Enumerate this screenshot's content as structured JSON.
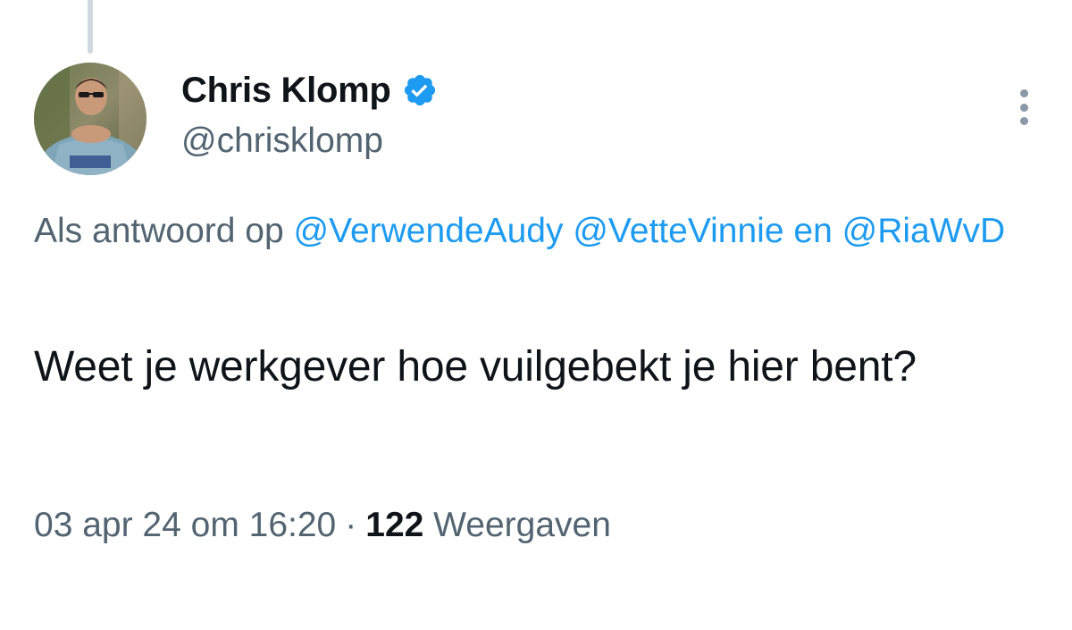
{
  "tweet": {
    "author": {
      "display_name": "Chris Klomp",
      "handle": "@chrisklomp",
      "verified": true,
      "avatar_icon": "user-photo"
    },
    "reply_context": {
      "prefix": "Als antwoord op",
      "mention_1": "@VerwendeAudy",
      "mention_2": "@VetteVinnie",
      "joiner": "en",
      "mention_3": "@RiaWvD"
    },
    "text": "Weet je werkgever hoe vuilgebekt je hier bent?",
    "timestamp": "03 apr 24 om 16:20",
    "separator": "·",
    "views_count": "122",
    "views_label": "Weergaven"
  },
  "colors": {
    "link": "#1d9bf0",
    "secondary_text": "#536471",
    "primary_text": "#0f1419",
    "verified_badge": "#1d9bf0"
  },
  "icons": {
    "verified": "verified-badge-icon",
    "more": "more-options-icon"
  }
}
